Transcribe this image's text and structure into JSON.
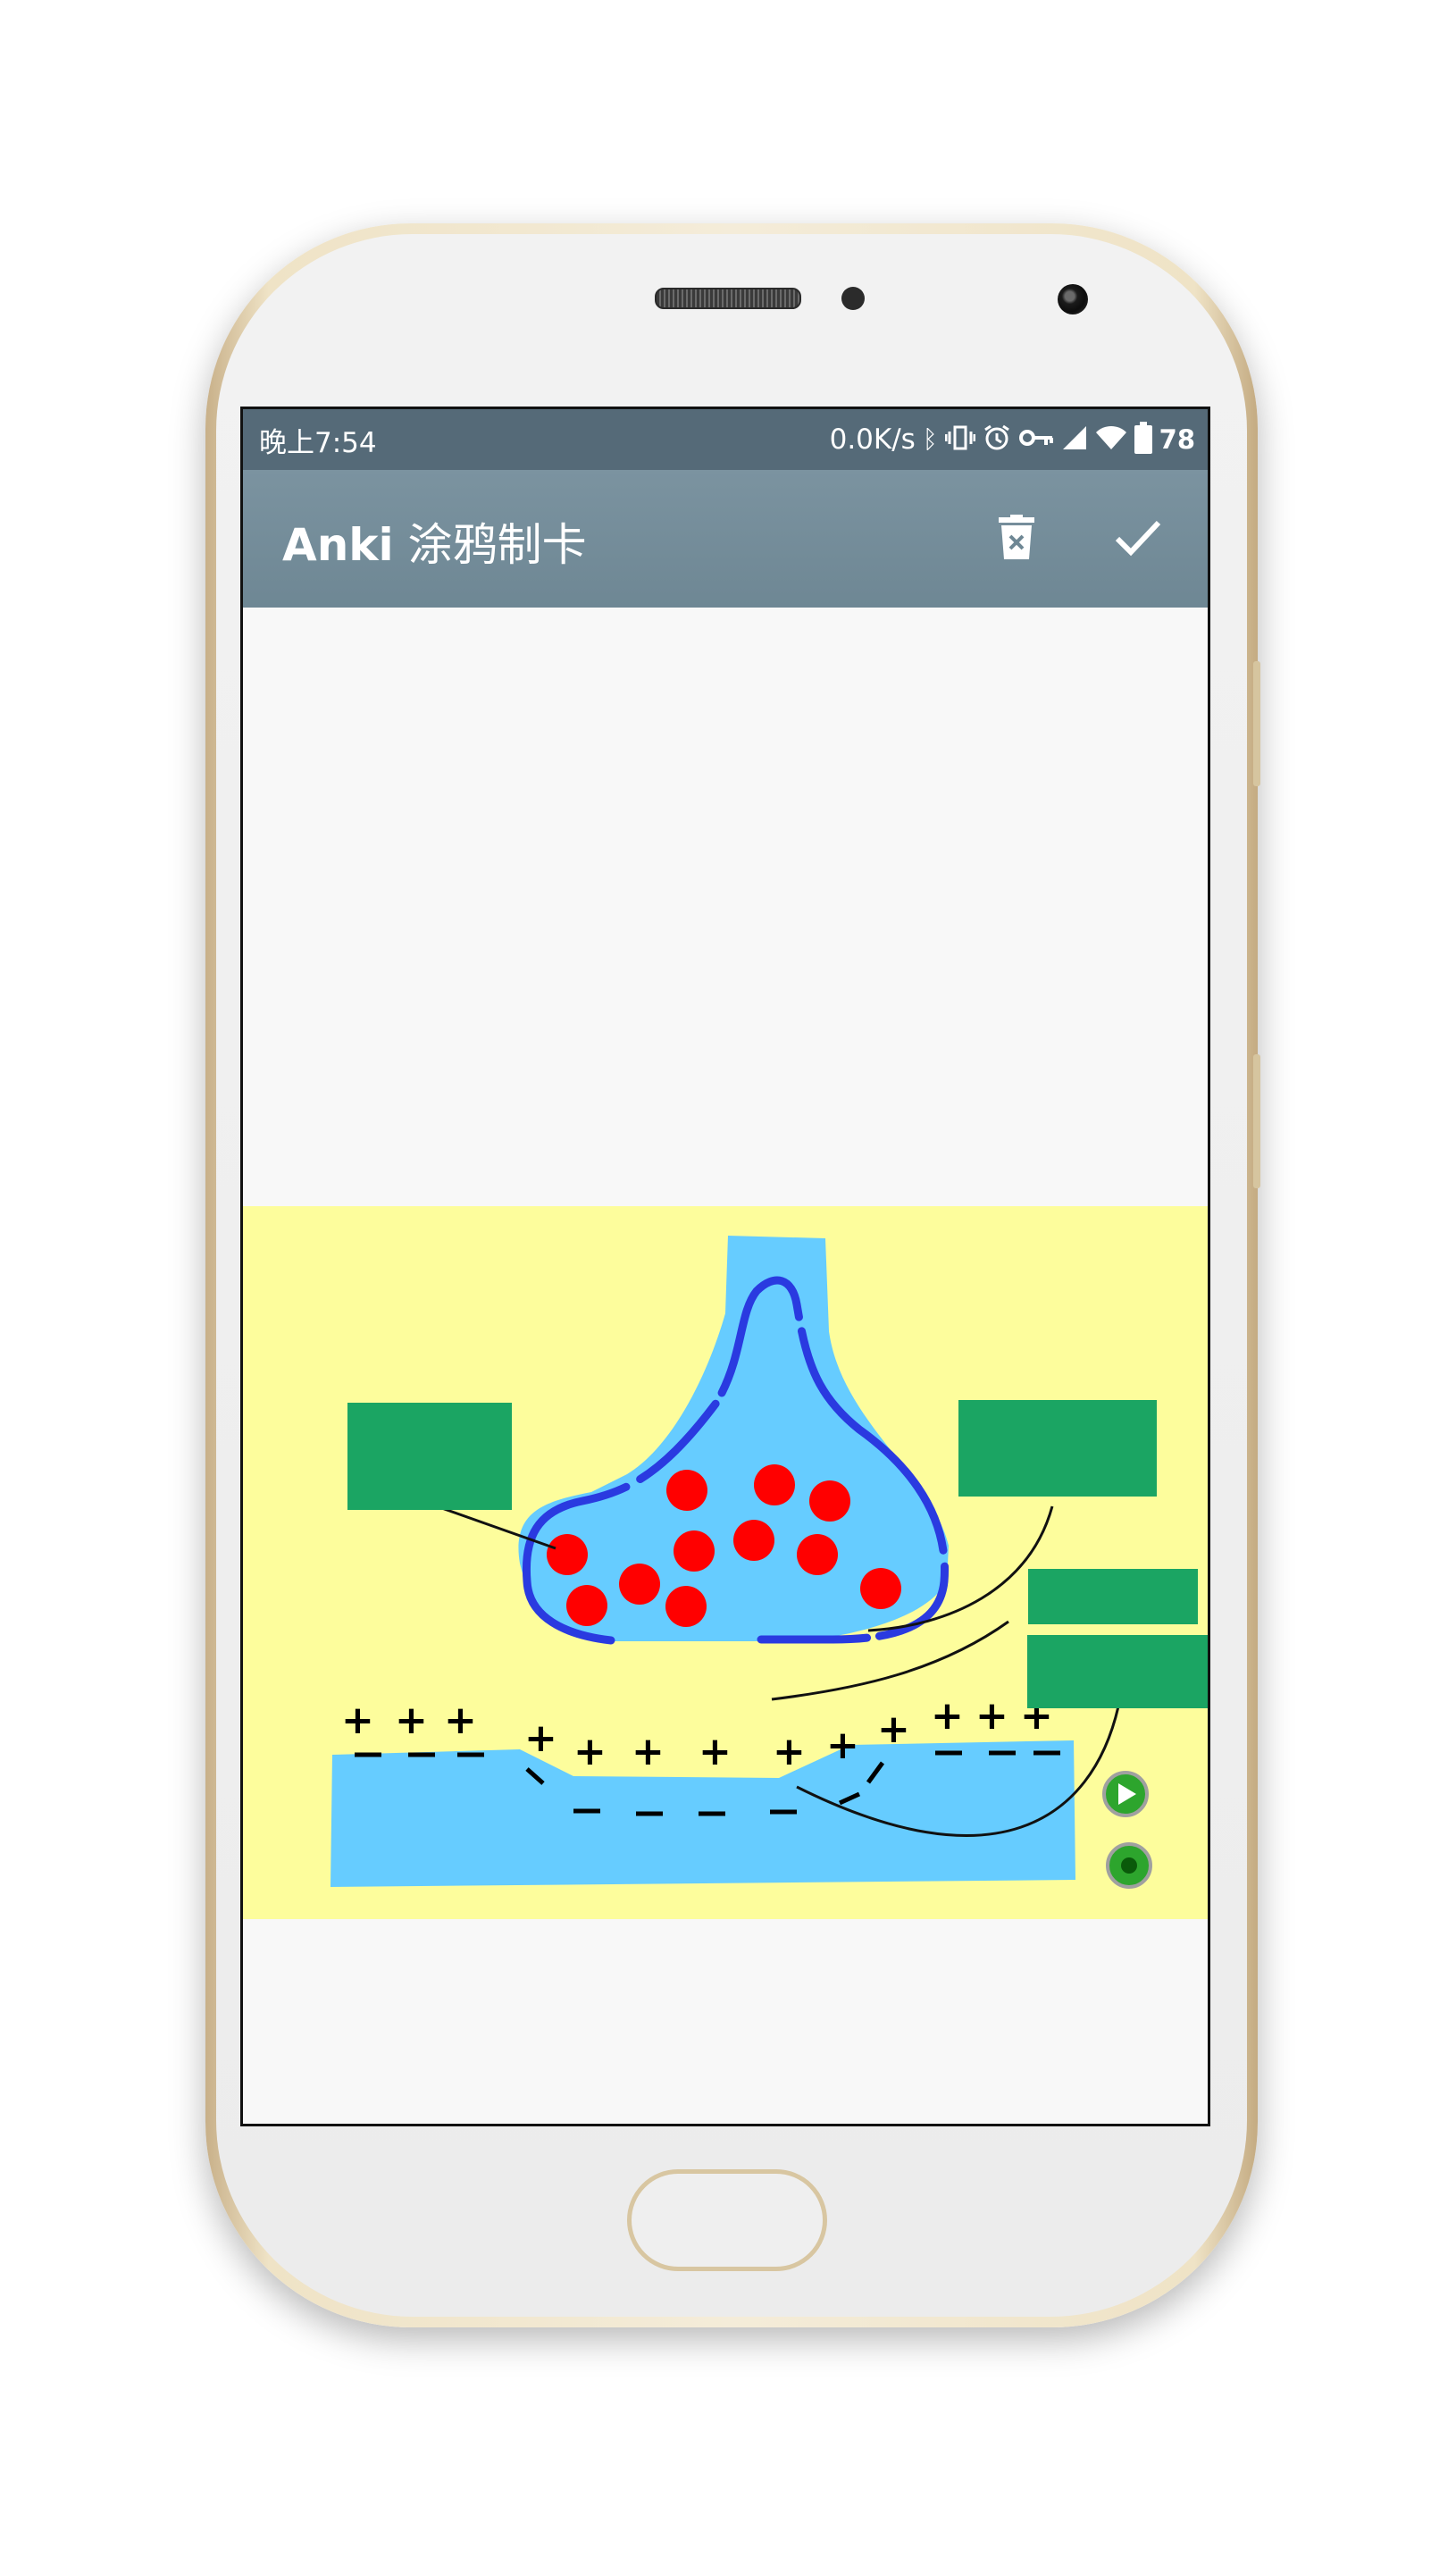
{
  "status_bar": {
    "time": "晚上7:54",
    "net_speed": "0.0K/s",
    "battery_level": "78",
    "icons": [
      "bluetooth-icon",
      "vibrate-icon",
      "alarm-icon",
      "vpn-key-icon",
      "signal-icon",
      "wifi-icon",
      "battery-icon"
    ]
  },
  "app_bar": {
    "title_prefix": "Anki",
    "title_suffix": " 涂鸦制卡",
    "actions": [
      "delete-icon",
      "check-icon"
    ]
  },
  "drawing": {
    "background_color": "#fdfd9c",
    "fluid_color": "#66ccff",
    "membrane_color": "#2a3ae0",
    "vesicle_color": "#ff0000",
    "label_box_color": "#1ba563",
    "charge_symbols": [
      "+",
      "–"
    ],
    "controls": [
      "play-button",
      "record-button"
    ]
  }
}
